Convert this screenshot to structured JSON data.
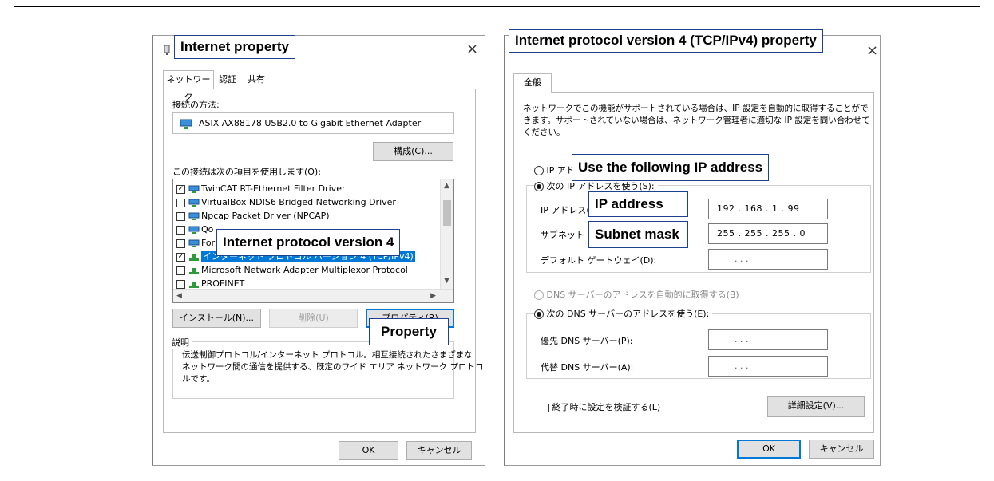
{
  "callouts": {
    "internet_property": "Internet property",
    "ipv4_property": "Internet protocol version 4 (TCP/IPv4) property",
    "protocol_v4": "Internet protocol version 4",
    "property": "Property",
    "use_following_ip": "Use the following IP address",
    "ip_address": "IP address",
    "subnet_mask": "Subnet mask"
  },
  "dialog1": {
    "close_glyph": "×",
    "tabs": [
      "ネットワーク",
      "認証",
      "共有"
    ],
    "connect_using_label": "接続の方法:",
    "adapter_name": "ASIX AX88178 USB2.0 to Gigabit Ethernet Adapter",
    "configure_button": "構成(C)...",
    "items_label": "この接続は次の項目を使用します(O):",
    "items": [
      {
        "label": "TwinCAT RT-Ethernet Filter Driver",
        "checked": true
      },
      {
        "label": "VirtualBox NDIS6 Bridged Networking Driver",
        "checked": false
      },
      {
        "label": "Npcap Packet Driver (NPCAP)",
        "checked": false
      },
      {
        "label": "Qo",
        "checked": false
      },
      {
        "label": "For",
        "checked": false
      },
      {
        "label": "インターネット プロトコル バージョン 4 (TCP/IPv4)",
        "checked": true,
        "selected": true
      },
      {
        "label": "Microsoft Network Adapter Multiplexor Protocol",
        "checked": false
      },
      {
        "label": "PROFINET",
        "checked": false
      }
    ],
    "install_button": "インストール(N)...",
    "uninstall_button": "削除(U)",
    "properties_button": "プロパティ(R)",
    "description_label": "説明",
    "description_text": [
      "伝送制御プロトコル/インターネット プロトコル。相互接続されたさまざまな",
      "ネットワーク間の通信を提供する、既定のワイド エリア ネットワーク プロトコ",
      "ルです。"
    ],
    "ok_button": "OK",
    "cancel_button": "キャンセル"
  },
  "dialog2": {
    "close_glyph": "×",
    "tab": "全般",
    "intro": [
      "ネットワークでこの機能がサポートされている場合は、IP 設定を自動的に取得することがで",
      "きます。サポートされていない場合は、ネットワーク管理者に適切な IP 設定を問い合わせて",
      "ください。"
    ],
    "auto_ip_fragment": "IP アド",
    "use_ip_radio": "次の IP アドレスを使う(S):",
    "ip_label": "IP アドレス(I):",
    "subnet_label": "サブネット マ",
    "gateway_label": "デフォルト ゲートウェイ(D):",
    "ip_value": "192 . 168 .  1  . 99",
    "subnet_value": "255 . 255 . 255 .  0",
    "empty_ip": ".       .       .",
    "dns_auto_radio": "DNS サーバーのアドレスを自動的に取得する(B)",
    "dns_manual_radio": "次の DNS サーバーのアドレスを使う(E):",
    "preferred_dns_label": "優先 DNS サーバー(P):",
    "alternate_dns_label": "代替 DNS サーバー(A):",
    "validate_checkbox": "終了時に設定を検証する(L)",
    "advanced_button": "詳細設定(V)...",
    "ok_button": "OK",
    "cancel_button": "キャンセル"
  }
}
